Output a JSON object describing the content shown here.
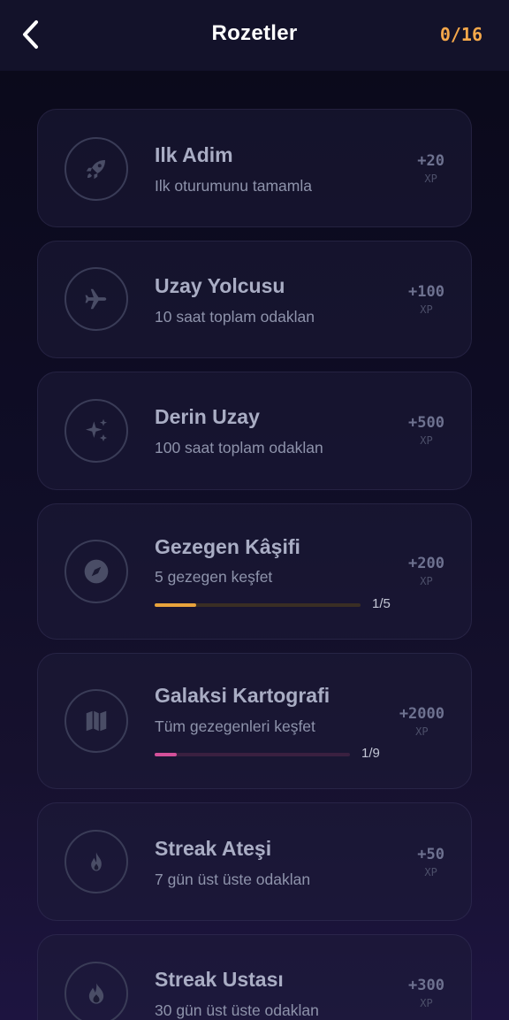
{
  "header": {
    "title": "Rozetler",
    "count": "0/16"
  },
  "badges": [
    {
      "name": "Ilk Adim",
      "description": "Ilk oturumunu tamamla",
      "xp": "+20",
      "xp_unit": "XP",
      "icon": "rocket-icon"
    },
    {
      "name": "Uzay Yolcusu",
      "description": "10 saat toplam odaklan",
      "xp": "+100",
      "xp_unit": "XP",
      "icon": "airplane-icon"
    },
    {
      "name": "Derin Uzay",
      "description": "100 saat toplam odaklan",
      "xp": "+500",
      "xp_unit": "XP",
      "icon": "sparkles-icon"
    },
    {
      "name": "Gezegen Kâşifi",
      "description": "5 gezegen keşfet",
      "xp": "+200",
      "xp_unit": "XP",
      "icon": "compass-icon",
      "progress": {
        "current": 1,
        "total": 5,
        "label": "1/5",
        "color": "#e8a33c"
      }
    },
    {
      "name": "Galaksi Kartografi",
      "description": "Tüm gezegenleri keşfet",
      "xp": "+2000",
      "xp_unit": "XP",
      "icon": "map-icon",
      "progress": {
        "current": 1,
        "total": 9,
        "label": "1/9",
        "color": "#d4509a"
      }
    },
    {
      "name": "Streak Ateşi",
      "description": "7 gün üst üste odaklan",
      "xp": "+50",
      "xp_unit": "XP",
      "icon": "flame-icon"
    },
    {
      "name": "Streak Ustası",
      "description": "30 gün üst üste odaklan",
      "xp": "+300",
      "xp_unit": "XP",
      "icon": "fire-icon"
    }
  ]
}
